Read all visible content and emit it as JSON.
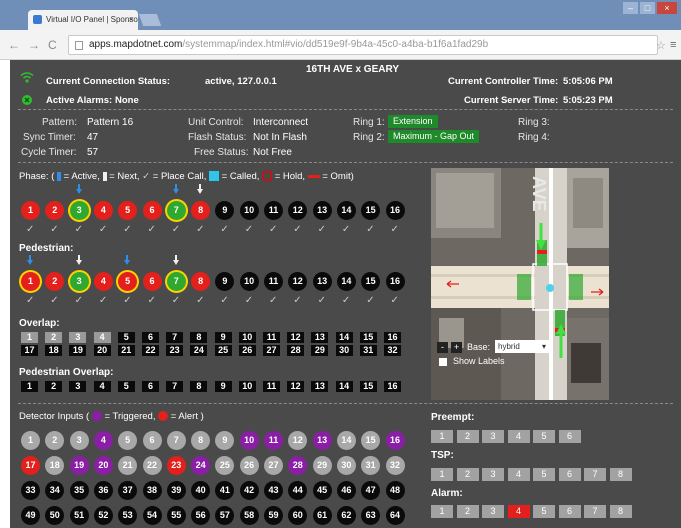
{
  "browser": {
    "tab_title": "Virtual I/O Panel | Sponso...",
    "tab_close": "×",
    "url_host": "apps.mapdotnet.com",
    "url_path": "/systemmap/index.html#vio/dd519e9f-9b4a-45c0-a4ba-b1f6a1fad29b",
    "back": "←",
    "forward": "→",
    "reload": "C",
    "star": "☆",
    "menu": "≡",
    "minimize": "–",
    "maximize": "□",
    "close": "×"
  },
  "header": {
    "intersection": "16TH AVE x GEARY",
    "connection_label": "Current Connection Status:",
    "connection_value": "active, 127.0.0.1",
    "alarms_label": "Active Alarms:",
    "alarms_value": "None",
    "controller_time_label": "Current Controller Time:",
    "controller_time_value": "5:05:06 PM",
    "server_time_label": "Current Server Time:",
    "server_time_value": "5:05:23 PM"
  },
  "status": {
    "pattern_label": "Pattern:",
    "pattern_value": "Pattern 16",
    "sync_label": "Sync Timer:",
    "sync_value": "47",
    "cycle_label": "Cycle Timer:",
    "cycle_value": "57",
    "unit_label": "Unit Control:",
    "unit_value": "Interconnect",
    "flash_label": "Flash Status:",
    "flash_value": "Not In Flash",
    "free_label": "Free Status:",
    "free_value": "Not Free",
    "ring1_label": "Ring 1:",
    "ring1_value": "Extension",
    "ring2_label": "Ring 2:",
    "ring2_value": "Maximum - Gap Out",
    "ring3_label": "Ring 3:",
    "ring4_label": "Ring 4:"
  },
  "legend": {
    "phase_prefix": "Phase: (",
    "active": "= Active,",
    "next": "= Next,",
    "place_call": "= Place Call,",
    "called": "= Called,",
    "hold": "= Hold,",
    "omit": "= Omit)"
  },
  "phases": {
    "labels": [
      "1",
      "2",
      "3",
      "4",
      "5",
      "6",
      "7",
      "8",
      "9",
      "10",
      "11",
      "12",
      "13",
      "14",
      "15",
      "16"
    ],
    "colors": [
      "red",
      "red",
      "green",
      "red",
      "red",
      "red",
      "green",
      "red",
      "black",
      "black",
      "black",
      "black",
      "black",
      "black",
      "black",
      "black"
    ],
    "ringed": [
      false,
      false,
      true,
      false,
      false,
      false,
      true,
      false,
      false,
      false,
      false,
      false,
      false,
      false,
      false,
      false
    ],
    "arrows": [
      "",
      "",
      "blue",
      "",
      "",
      "",
      "blue",
      "white",
      "",
      "",
      "",
      "",
      "",
      "",
      "",
      ""
    ],
    "check": "✓"
  },
  "pedestrian": {
    "title": "Pedestrian:",
    "labels": [
      "1",
      "2",
      "3",
      "4",
      "5",
      "6",
      "7",
      "8",
      "9",
      "10",
      "11",
      "12",
      "13",
      "14",
      "15",
      "16"
    ],
    "colors": [
      "red",
      "red",
      "green",
      "red",
      "red",
      "red",
      "green",
      "red",
      "black",
      "black",
      "black",
      "black",
      "black",
      "black",
      "black",
      "black"
    ],
    "ringed": [
      true,
      false,
      true,
      false,
      true,
      false,
      true,
      false,
      false,
      false,
      false,
      false,
      false,
      false,
      false,
      false
    ],
    "arrows": [
      "blue",
      "",
      "white",
      "",
      "blue",
      "",
      "white",
      "",
      "",
      "",
      "",
      "",
      "",
      "",
      "",
      ""
    ]
  },
  "overlap": {
    "title": "Overlap:",
    "row1": [
      "1",
      "2",
      "3",
      "4",
      "5",
      "6",
      "7",
      "8",
      "9",
      "10",
      "11",
      "12",
      "13",
      "14",
      "15",
      "16"
    ],
    "row1_gray": [
      true,
      true,
      true,
      true,
      false,
      false,
      false,
      false,
      false,
      false,
      false,
      false,
      false,
      false,
      false,
      false
    ],
    "row2": [
      "17",
      "18",
      "19",
      "20",
      "21",
      "22",
      "23",
      "24",
      "25",
      "26",
      "27",
      "28",
      "29",
      "30",
      "31",
      "32"
    ]
  },
  "ped_overlap": {
    "title": "Pedestrian Overlap:",
    "items": [
      "1",
      "2",
      "3",
      "4",
      "5",
      "6",
      "7",
      "8",
      "9",
      "10",
      "11",
      "12",
      "13",
      "14",
      "15",
      "16"
    ]
  },
  "detector": {
    "title_prefix": "Detector Inputs (",
    "triggered": "= Triggered,",
    "alert": "= Alert )",
    "row1": [
      "1",
      "2",
      "3",
      "4",
      "5",
      "6",
      "7",
      "8",
      "9",
      "10",
      "11",
      "12",
      "13",
      "14",
      "15",
      "16"
    ],
    "row1_colors": [
      "gray",
      "gray",
      "gray",
      "purple",
      "gray",
      "gray",
      "gray",
      "gray",
      "gray",
      "purple",
      "purple",
      "gray",
      "purple",
      "gray",
      "gray",
      "purple"
    ],
    "row2": [
      "17",
      "18",
      "19",
      "20",
      "21",
      "22",
      "23",
      "24",
      "25",
      "26",
      "27",
      "28",
      "29",
      "30",
      "31",
      "32"
    ],
    "row2_colors": [
      "red",
      "gray",
      "purple",
      "purple",
      "gray",
      "gray",
      "red",
      "purple",
      "gray",
      "gray",
      "gray",
      "purple",
      "gray",
      "gray",
      "gray",
      "gray"
    ],
    "row3": [
      "33",
      "34",
      "35",
      "36",
      "37",
      "38",
      "39",
      "40",
      "41",
      "42",
      "43",
      "44",
      "45",
      "46",
      "47",
      "48"
    ],
    "row4": [
      "49",
      "50",
      "51",
      "52",
      "53",
      "54",
      "55",
      "56",
      "57",
      "58",
      "59",
      "60",
      "61",
      "62",
      "63",
      "64"
    ]
  },
  "map": {
    "street_label": "AVE",
    "zoom_out": "-",
    "zoom_in": "+",
    "base_label": "Base:",
    "base_value": "hybrid",
    "show_labels": "Show Labels"
  },
  "preempt": {
    "title": "Preempt:",
    "items": [
      "1",
      "2",
      "3",
      "4",
      "5",
      "6"
    ]
  },
  "tsp": {
    "title": "TSP:",
    "items": [
      "1",
      "2",
      "3",
      "4",
      "5",
      "6",
      "7",
      "8"
    ]
  },
  "alarm": {
    "title": "Alarm:",
    "items": [
      "1",
      "2",
      "3",
      "4",
      "5",
      "6",
      "7",
      "8"
    ],
    "active_index": 3
  },
  "colors": {
    "red": "#e3201b",
    "green": "#2fa82f",
    "purple": "#8a1fa6",
    "gray": "#a8a8a8",
    "ring_green": "#1f8a2a",
    "background": "#4a4a4a"
  }
}
